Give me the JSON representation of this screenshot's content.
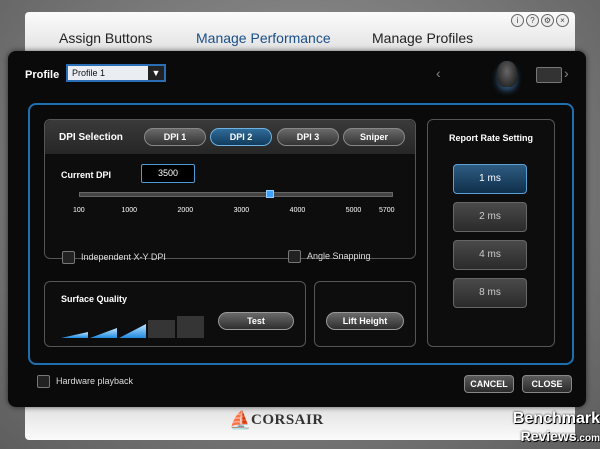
{
  "tabs": [
    {
      "label": "Assign Buttons"
    },
    {
      "label": "Manage Performance"
    },
    {
      "label": "Manage Profiles"
    }
  ],
  "window_icons": [
    "info-icon",
    "help-icon",
    "settings-icon",
    "close-icon"
  ],
  "window_icon_glyphs": [
    "i",
    "?",
    "⚙",
    "×"
  ],
  "profile": {
    "label": "Profile",
    "selected": "Profile 1"
  },
  "dpi": {
    "title": "DPI Selection",
    "options": [
      "DPI 1",
      "DPI 2",
      "DPI 3",
      "Sniper"
    ],
    "selected": "DPI 2",
    "current_label": "Current DPI",
    "current_value": "3500",
    "slider_value": 3500,
    "slider_min": 100,
    "slider_max": 5700,
    "ticks": [
      "100",
      "1000",
      "2000",
      "3000",
      "4000",
      "5000",
      "5700"
    ],
    "independent_xy": "Independent X-Y DPI",
    "angle_snapping": "Angle Snapping"
  },
  "surface": {
    "title": "Surface Quality",
    "test_label": "Test",
    "quality_bars": 5,
    "quality_level": 3
  },
  "lift": {
    "label": "Lift Height"
  },
  "report_rate": {
    "title": "Report Rate Setting",
    "options": [
      "1 ms",
      "2 ms",
      "4 ms",
      "8 ms"
    ],
    "selected": "1 ms"
  },
  "footer": {
    "hardware_playback": "Hardware playback",
    "cancel": "CANCEL",
    "close": "CLOSE"
  },
  "brand": {
    "logo": "CORSAIR"
  },
  "watermark": {
    "line1": "Benchmark",
    "line2": "Reviews",
    "line2_suffix": ".com"
  },
  "colors": {
    "accent": "#1e6fb0",
    "active_button": "#2f6c9a",
    "panel": "#0a0a0a"
  }
}
